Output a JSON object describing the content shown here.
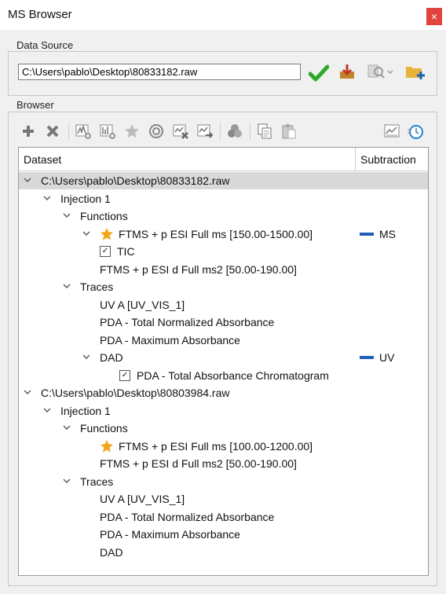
{
  "window": {
    "title": "MS Browser",
    "close_glyph": "×"
  },
  "data_source": {
    "label": "Data Source",
    "path_value": "C:\\Users\\pablo\\Desktop\\80833182.raw",
    "icons": [
      "confirm-check-icon",
      "download-icon",
      "search-options-icon",
      "open-folder-add-icon"
    ]
  },
  "browser": {
    "label": "Browser",
    "toolbar_icons": [
      "add-icon",
      "remove-icon",
      "add-spectrum-icon",
      "add-chromatogram-icon",
      "favorite-star-icon",
      "target-icon",
      "remove-trace-icon",
      "export-trace-icon",
      "color-blend-icon",
      "copy-icon",
      "paste-icon",
      "chart-settings-icon",
      "timer-icon"
    ],
    "columns": {
      "dataset": "Dataset",
      "subtraction": "Subtraction"
    },
    "rows": [
      {
        "level": 0,
        "expanded": true,
        "text": "C:\\Users\\pablo\\Desktop\\80833182.raw",
        "selected": true
      },
      {
        "level": 1,
        "expanded": true,
        "text": "Injection 1"
      },
      {
        "level": 2,
        "expanded": true,
        "text": "Functions"
      },
      {
        "level": 3,
        "expanded": true,
        "star": true,
        "text": "FTMS + p ESI Full ms [150.00-1500.00]",
        "sub": "MS"
      },
      {
        "level": 4,
        "check": true,
        "text": "TIC"
      },
      {
        "level": 4,
        "text": "FTMS + p ESI d Full ms2 [50.00-190.00]"
      },
      {
        "level": 2,
        "expanded": true,
        "text": "Traces"
      },
      {
        "level": 4,
        "text": "UV A [UV_VIS_1]"
      },
      {
        "level": 4,
        "text": "PDA - Total Normalized Absorbance"
      },
      {
        "level": 4,
        "text": "PDA - Maximum Absorbance"
      },
      {
        "level": 3,
        "expanded": true,
        "text": "DAD",
        "sub": "UV"
      },
      {
        "level": 5,
        "check": true,
        "text": "PDA - Total Absorbance Chromatogram"
      },
      {
        "level": 0,
        "expanded": true,
        "text": "C:\\Users\\pablo\\Desktop\\80803984.raw"
      },
      {
        "level": 1,
        "expanded": true,
        "text": "Injection 1"
      },
      {
        "level": 2,
        "expanded": true,
        "text": "Functions"
      },
      {
        "level": 4,
        "star": true,
        "text": "FTMS + p ESI Full ms [100.00-1200.00]"
      },
      {
        "level": 4,
        "text": "FTMS + p ESI d Full ms2 [50.00-190.00]"
      },
      {
        "level": 2,
        "expanded": true,
        "text": "Traces"
      },
      {
        "level": 4,
        "text": "UV A [UV_VIS_1]"
      },
      {
        "level": 4,
        "text": "PDA - Total Normalized Absorbance"
      },
      {
        "level": 4,
        "text": "PDA - Maximum Absorbance"
      },
      {
        "level": 4,
        "text": "DAD"
      }
    ]
  },
  "colors": {
    "accent_blue": "#1f5fb5",
    "star": "#f2a51a",
    "check_green": "#2fa829",
    "close_red": "#e0443c"
  }
}
